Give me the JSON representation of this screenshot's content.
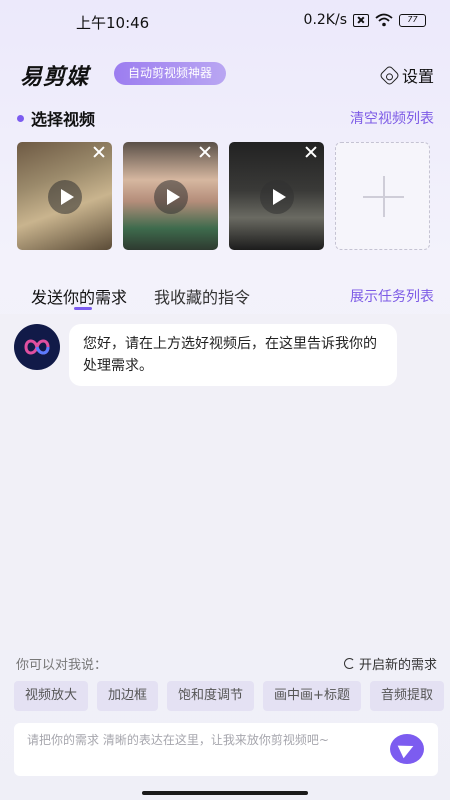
{
  "status_bar": {
    "time": "上午10:46",
    "network_speed": "0.2K/s",
    "battery": "77"
  },
  "header": {
    "logo": "易剪媒",
    "slogan": "自动剪视频神器",
    "settings_label": "设置"
  },
  "video_section": {
    "title": "选择视频",
    "clear_label": "清空视频列表",
    "videos": [
      {
        "id": "video-1"
      },
      {
        "id": "video-2"
      },
      {
        "id": "video-3"
      }
    ]
  },
  "tabs": [
    {
      "label": "发送你的需求",
      "active": true
    },
    {
      "label": "我收藏的指令",
      "active": false
    }
  ],
  "task_list_label": "展示任务列表",
  "chat": {
    "bot_message": "您好，请在上方选好视频后，在这里告诉我你的处理需求。"
  },
  "suggestions": {
    "title": "你可以对我说：",
    "new_request_label": "开启新的需求",
    "chips": [
      "视频放大",
      "加边框",
      "饱和度调节",
      "画中画+标题",
      "音频提取"
    ]
  },
  "input": {
    "placeholder": "请把你的需求 清晰的表达在这里，让我来放你剪视频吧~"
  },
  "colors": {
    "accent": "#7c5cf0",
    "link": "#7d5be6"
  }
}
